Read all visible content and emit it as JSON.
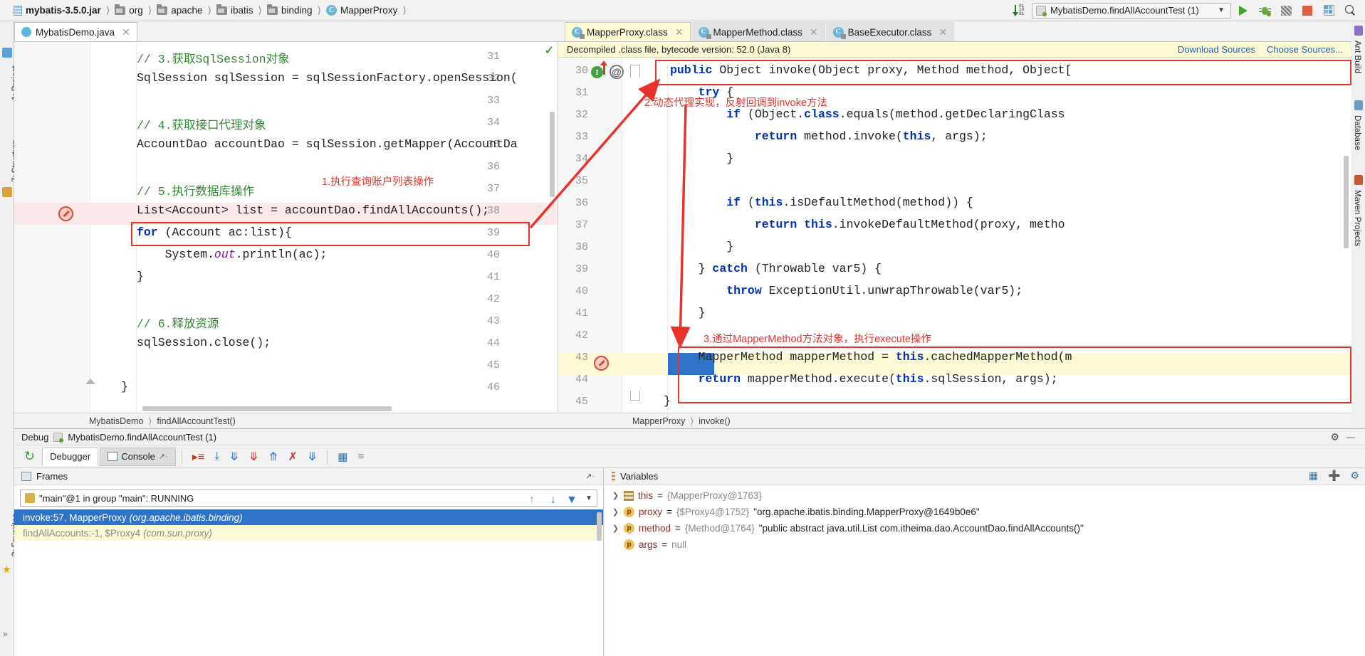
{
  "topbar": {
    "breadcrumbs": [
      {
        "icon": "jar-icon",
        "label": "mybatis-3.5.0.jar",
        "bold": true
      },
      {
        "icon": "folder-icon",
        "label": "org",
        "bold": false
      },
      {
        "icon": "folder-icon",
        "label": "apache",
        "bold": false
      },
      {
        "icon": "folder-icon",
        "label": "ibatis",
        "bold": false
      },
      {
        "icon": "folder-icon",
        "label": "binding",
        "bold": false
      },
      {
        "icon": "class-icon",
        "label": "MapperProxy",
        "bold": false
      }
    ],
    "run_config": "MybatisDemo.findAllAccountTest (1)",
    "buttons": [
      "run-button",
      "debug-button",
      "coverage-button",
      "stop-button",
      "layout-button",
      "search-button"
    ]
  },
  "left_editor": {
    "tab": {
      "label": "MybatisDemo.java",
      "close": "✕"
    },
    "first_line_number": 31,
    "lines": [
      {
        "n": 31,
        "html": "<span class='cm'>// 3.获取SqlSession对象</span>"
      },
      {
        "n": 32,
        "html": "SqlSession sqlSession = sqlSessionFactory.openSession("
      },
      {
        "n": 33,
        "html": ""
      },
      {
        "n": 34,
        "html": "<span class='cm'>// 4.获取接口代理对象</span>"
      },
      {
        "n": 35,
        "html": "AccountDao accountDao = sqlSession.getMapper(AccountDa"
      },
      {
        "n": 36,
        "html": ""
      },
      {
        "n": 37,
        "html": "<span class='cm'>// 5.执行数据库操作</span>"
      },
      {
        "n": 38,
        "html": "List&lt;Account&gt; list = accountDao.findAllAccounts();"
      },
      {
        "n": 39,
        "html": "<span class='kw'>for</span> (Account ac:list){"
      },
      {
        "n": 40,
        "html": "    System.<span class='fld'>out</span>.println(ac);"
      },
      {
        "n": 41,
        "html": "}"
      },
      {
        "n": 42,
        "html": ""
      },
      {
        "n": 43,
        "html": "<span class='cm'>// 6.释放资源</span>"
      },
      {
        "n": 44,
        "html": "sqlSession.close();"
      },
      {
        "n": 45,
        "html": ""
      },
      {
        "n": 46,
        "html": "}"
      }
    ],
    "breakpoint_line": 38,
    "status_breadcrumb": [
      "MybatisDemo",
      "findAllAccountTest()"
    ]
  },
  "right_editor": {
    "tabs": [
      {
        "label": "MapperProxy.class",
        "active": true
      },
      {
        "label": "MapperMethod.class",
        "active": false
      },
      {
        "label": "BaseExecutor.class",
        "active": false
      }
    ],
    "banner": {
      "text": "Decompiled .class file, bytecode version: 52.0 (Java 8)",
      "download_sources": "Download Sources",
      "choose_sources": "Choose Sources..."
    },
    "lines": [
      {
        "n": 30,
        "html": "<span class='kw'>public</span> Object invoke(Object proxy, Method method, Object["
      },
      {
        "n": 31,
        "html": "    <span class='kw'>try</span> {"
      },
      {
        "n": 32,
        "html": "        <span class='kw'>if</span> (Object.<span class='kw'>class</span>.equals(method.getDeclaringClass"
      },
      {
        "n": 33,
        "html": "            <span class='kw'>return</span> method.invoke(<span class='kw'>this</span>, args);"
      },
      {
        "n": 34,
        "html": "        }"
      },
      {
        "n": 35,
        "html": ""
      },
      {
        "n": 36,
        "html": "        <span class='kw'>if</span> (<span class='kw'>this</span>.isDefaultMethod(method)) {"
      },
      {
        "n": 37,
        "html": "            <span class='kw'>return</span> <span class='kw'>this</span>.invokeDefaultMethod(proxy, metho"
      },
      {
        "n": 38,
        "html": "        }"
      },
      {
        "n": 39,
        "html": "    } <span class='kw'>catch</span> (Throwable var5) {"
      },
      {
        "n": 40,
        "html": "        <span class='kw'>throw</span> ExceptionUtil.unwrapThrowable(var5);"
      },
      {
        "n": 41,
        "html": "    }"
      },
      {
        "n": 42,
        "html": ""
      },
      {
        "n": 43,
        "html": "    MapperMethod mapperMethod = <span class='kw'>this</span>.cachedMapperMethod(m"
      },
      {
        "n": 44,
        "html": "    <span class='kw'>return</span> mapperMethod.execute(<span class='kw'>this</span>.sqlSession, args);"
      },
      {
        "n": 45,
        "html": "}"
      }
    ],
    "current_line": 43,
    "status_breadcrumb": [
      "MapperProxy",
      "invoke()"
    ]
  },
  "annotations": [
    {
      "id": "anno-1",
      "text": "1.执行查询账户列表操作"
    },
    {
      "id": "anno-2",
      "text": "2.动态代理实现，反射回调到invoke方法"
    },
    {
      "id": "anno-3",
      "text": "3.通过MapperMethod方法对象，执行execute操作"
    }
  ],
  "debug": {
    "header_label": "Debug",
    "header_config": "MybatisDemo.findAllAccountTest (1)",
    "tabs": [
      {
        "label": "Debugger",
        "selected": true
      },
      {
        "label": "Console",
        "selected": false
      }
    ],
    "toolbar_icons": [
      "rerun-icon",
      "show-execution-point-icon",
      "step-over-icon",
      "step-into-icon",
      "force-step-into-icon",
      "step-out-icon",
      "drop-frame-icon",
      "run-to-cursor-icon",
      "evaluate-expression-icon",
      "mute-breakpoints-icon"
    ],
    "frames": {
      "title": "Frames",
      "thread": "\"main\"@1 in group \"main\": RUNNING",
      "rows": [
        {
          "text": "invoke:57, MapperProxy",
          "pkg": "(org.apache.ibatis.binding)",
          "selected": true
        },
        {
          "text": "findAllAccounts:-1, $Proxy4",
          "pkg": "(com.sun.proxy)",
          "selected": false
        }
      ]
    },
    "variables": {
      "title": "Variables",
      "rows": [
        {
          "icon": "this-icon",
          "name": "this",
          "eq": "=",
          "ref": "{MapperProxy@1763}",
          "str": ""
        },
        {
          "icon": "param-icon",
          "name": "proxy",
          "eq": "=",
          "ref": "{$Proxy4@1752}",
          "str": "\"org.apache.ibatis.binding.MapperProxy@1649b0e6\""
        },
        {
          "icon": "param-icon",
          "name": "method",
          "eq": "=",
          "ref": "{Method@1764}",
          "str": "\"public abstract java.util.List com.itheima.dao.AccountDao.findAllAccounts()\""
        },
        {
          "icon": "param-icon",
          "name": "args",
          "eq": "=",
          "ref": "null",
          "str": ""
        }
      ]
    }
  },
  "side_strips": {
    "left_top": [
      "1: Project",
      "7: Structure"
    ],
    "left_bottom": [
      "2: Favorites"
    ],
    "right": [
      "Ant Build",
      "Database",
      "Maven Projects"
    ]
  },
  "colors": {
    "accent_red": "#e8322c",
    "selection_blue": "#2f73c8",
    "banner_yellow": "#fcfbd6",
    "comment_green": "#348a34",
    "keyword_blue": "#0033b3"
  }
}
